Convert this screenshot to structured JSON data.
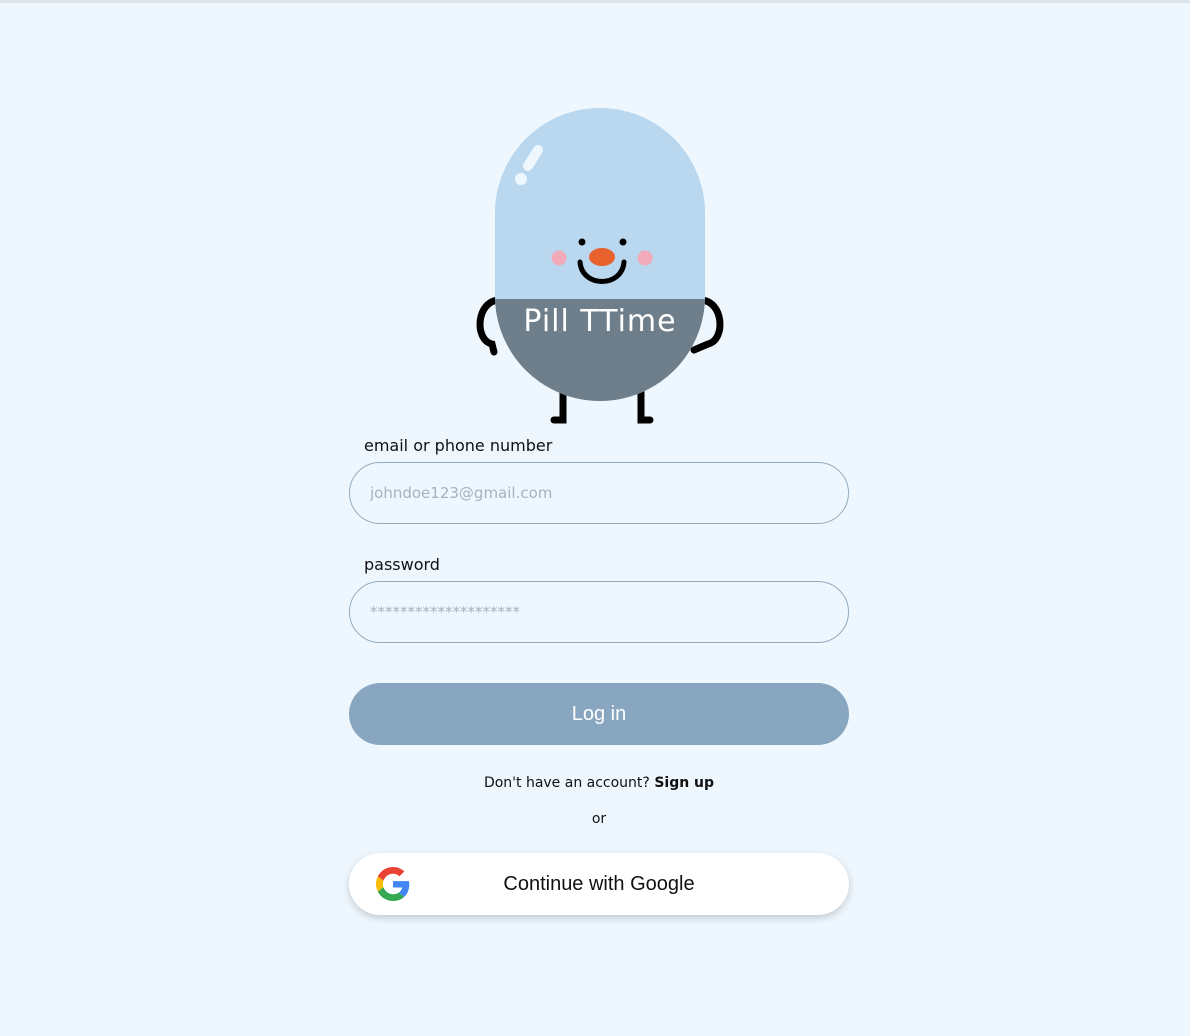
{
  "app": {
    "logo_text": "Pill TTime"
  },
  "form": {
    "email_label": "email or phone number",
    "email_placeholder": "johndoe123@gmail.com",
    "password_label": "password",
    "password_placeholder": "********************"
  },
  "actions": {
    "login_label": "Log in",
    "signup_prompt": "Don't have an account?",
    "signup_link": "Sign up",
    "or_text": "or",
    "google_label": "Continue with Google"
  },
  "colors": {
    "background": "#eef7fe",
    "pill_top": "#b9d7ef",
    "pill_bottom": "#6e7f8b",
    "login_button": "#88a6bf",
    "nose": "#e8622e",
    "cheeks": "#f0aab8"
  },
  "icons": {
    "mascot": "pill-mascot-icon",
    "google": "google-icon"
  }
}
